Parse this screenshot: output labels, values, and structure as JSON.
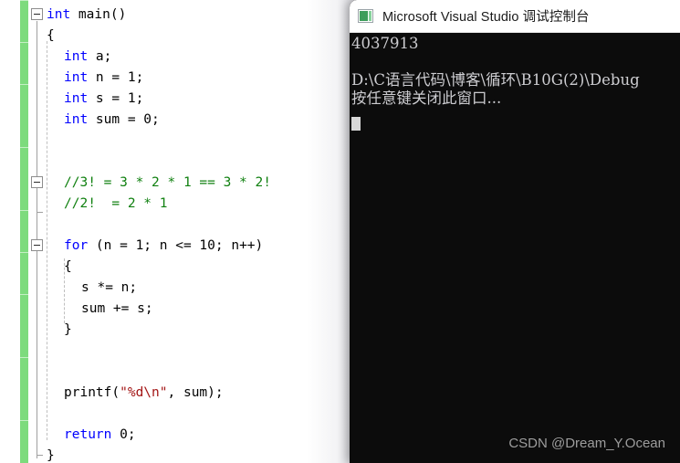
{
  "editor": {
    "name": "visual-studio-code-editor",
    "language": "c",
    "colors": {
      "background": "#ffffff",
      "keyword": "#0000ff",
      "comment": "#108010",
      "string": "#a31515",
      "plain": "#000000",
      "change_bar": "#7ddb7d",
      "current_line_border": "#dcdcec"
    },
    "current_line_index": 12,
    "lines": [
      {
        "indent": 0,
        "fold": "open",
        "tokens": [
          {
            "t": "int",
            "c": "kw"
          },
          {
            "t": " main()",
            "c": "pun"
          }
        ]
      },
      {
        "indent": 0,
        "fold": "none",
        "tokens": [
          {
            "t": "{",
            "c": "pun"
          }
        ]
      },
      {
        "indent": 1,
        "fold": "none",
        "tokens": [
          {
            "t": "int",
            "c": "kw"
          },
          {
            "t": " a;",
            "c": "pun"
          }
        ]
      },
      {
        "indent": 1,
        "fold": "none",
        "tokens": [
          {
            "t": "int",
            "c": "kw"
          },
          {
            "t": " n = 1;",
            "c": "pun"
          }
        ]
      },
      {
        "indent": 1,
        "fold": "none",
        "tokens": [
          {
            "t": "int",
            "c": "kw"
          },
          {
            "t": " s = 1;",
            "c": "pun"
          }
        ]
      },
      {
        "indent": 1,
        "fold": "none",
        "tokens": [
          {
            "t": "int",
            "c": "kw"
          },
          {
            "t": " sum = 0;",
            "c": "pun"
          }
        ]
      },
      {
        "indent": 0,
        "fold": "none",
        "tokens": []
      },
      {
        "indent": 0,
        "fold": "none",
        "tokens": []
      },
      {
        "indent": 1,
        "fold": "open",
        "tokens": [
          {
            "t": "//3! = 3 * 2 * 1 == 3 * 2!",
            "c": "cmt"
          }
        ]
      },
      {
        "indent": 1,
        "fold": "none",
        "tokens": [
          {
            "t": "//2!  = 2 * 1",
            "c": "cmt"
          }
        ]
      },
      {
        "indent": 0,
        "fold": "none",
        "tokens": []
      },
      {
        "indent": 1,
        "fold": "open",
        "tokens": [
          {
            "t": "for",
            "c": "kw"
          },
          {
            "t": " (n = 1; n <= 10; n++)",
            "c": "pun"
          }
        ]
      },
      {
        "indent": 1,
        "fold": "none",
        "tokens": [
          {
            "t": "{",
            "c": "pun"
          }
        ]
      },
      {
        "indent": 2,
        "fold": "none",
        "tokens": [
          {
            "t": "s *= n;",
            "c": "pun"
          }
        ]
      },
      {
        "indent": 2,
        "fold": "none",
        "tokens": [
          {
            "t": "sum += s;",
            "c": "pun"
          }
        ]
      },
      {
        "indent": 1,
        "fold": "none",
        "tokens": [
          {
            "t": "}",
            "c": "pun"
          }
        ]
      },
      {
        "indent": 0,
        "fold": "none",
        "tokens": []
      },
      {
        "indent": 0,
        "fold": "none",
        "tokens": []
      },
      {
        "indent": 1,
        "fold": "none",
        "tokens": [
          {
            "t": "printf(",
            "c": "pun"
          },
          {
            "t": "\"%d\\n\"",
            "c": "str"
          },
          {
            "t": ", sum);",
            "c": "pun"
          }
        ]
      },
      {
        "indent": 0,
        "fold": "none",
        "tokens": []
      },
      {
        "indent": 1,
        "fold": "none",
        "tokens": [
          {
            "t": "return",
            "c": "kw"
          },
          {
            "t": " 0;",
            "c": "pun"
          }
        ]
      },
      {
        "indent": 0,
        "fold": "none",
        "tokens": [
          {
            "t": "}",
            "c": "pun"
          }
        ]
      }
    ]
  },
  "console": {
    "window_title": "Microsoft Visual Studio 调试控制台",
    "icon": "console-app-icon",
    "background": "#0c0c0c",
    "text_color": "#ccccd0",
    "output_lines": [
      "4037913",
      "",
      "D:\\C语言代码\\博客\\循环\\B10G(2)\\Debug",
      "按任意键关闭此窗口..."
    ],
    "caret_visible": true
  },
  "watermark": {
    "text": "CSDN @Dream_Y.Ocean"
  }
}
